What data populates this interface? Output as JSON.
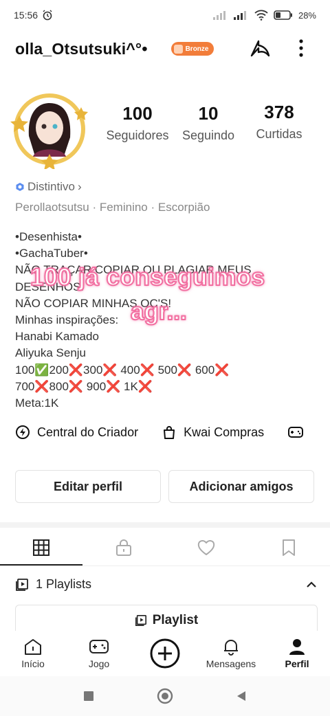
{
  "status_bar": {
    "time": "15:56",
    "battery": "28%"
  },
  "header": {
    "username": "olla_Otsutsuki^°•",
    "badge_label": "Bronze"
  },
  "profile": {
    "stats": [
      {
        "value": "100",
        "label": "Seguidores"
      },
      {
        "value": "10",
        "label": "Seguindo"
      },
      {
        "value": "378",
        "label": "Curtidas"
      }
    ],
    "distintivo_label": "Distintivo",
    "meta": "Perollaotsutsu · Feminino · Escorpião"
  },
  "bio": {
    "lines": [
      "•Desenhista•",
      "•GachaTuber•",
      "NÃO TRAÇAR COPIAR OU PLAGIAR MEUS",
      "DESENHOS!",
      "NÃO COPIAR MINHAS OC'S!",
      "Minhas inspirações:",
      "Hanabi Kamado",
      "Aliyuka Senju",
      "100✅200❌300❌ 400❌ 500❌ 600❌",
      "700❌800❌ 900❌ 1K❌",
      "Meta:1K"
    ]
  },
  "overlay": {
    "line1": "100 já conseguimos",
    "line2": "agr..."
  },
  "links": {
    "creator": "Central do Criador",
    "shop": "Kwai Compras"
  },
  "buttons": {
    "edit": "Editar perfil",
    "add_friends": "Adicionar amigos"
  },
  "playlists": {
    "summary": "1 Playlists",
    "button": "Playlist"
  },
  "bottom_nav": [
    {
      "label": "Início",
      "icon": "home-icon"
    },
    {
      "label": "Jogo",
      "icon": "gamepad-icon"
    },
    {
      "label": "",
      "icon": "plus-circle-icon"
    },
    {
      "label": "Mensagens",
      "icon": "bell-icon"
    },
    {
      "label": "Perfil",
      "icon": "person-icon"
    }
  ],
  "colors": {
    "bronze": "#f27d3a",
    "overlay_stroke": "#f26ea0",
    "badge_blue": "#5b8def"
  }
}
